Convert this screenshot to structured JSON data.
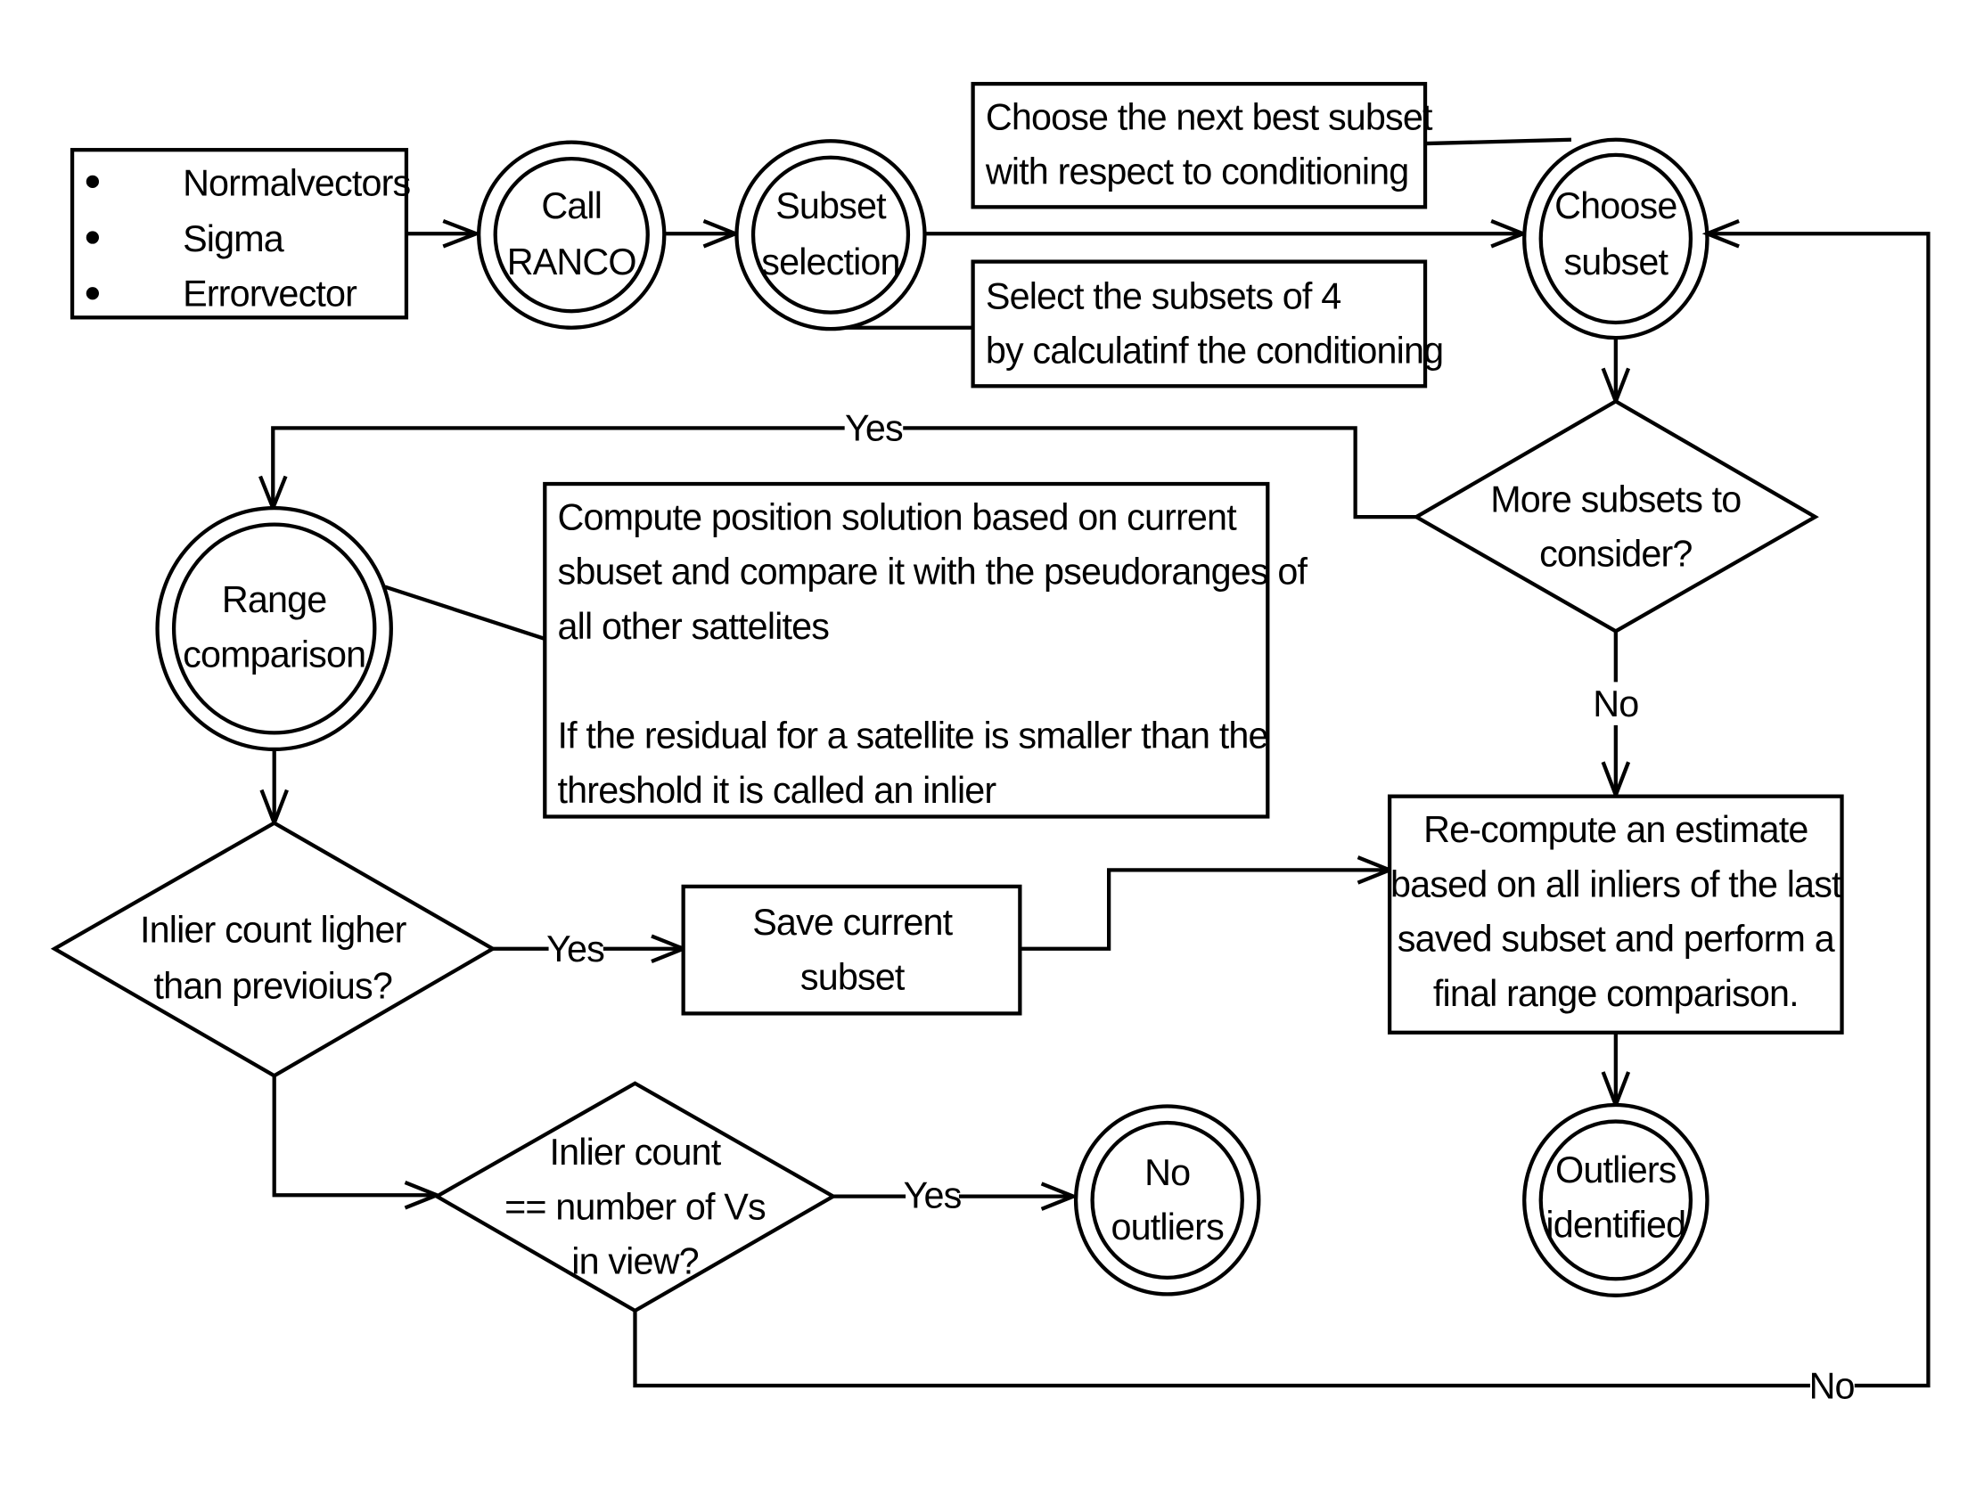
{
  "diagram": {
    "type": "flowchart",
    "input_box": {
      "bullet_icon": "bullet-dot",
      "items": [
        "Normalvectors",
        "Sigma",
        "Errorvector"
      ]
    },
    "nodes": {
      "call_ranco": [
        "Call",
        "RANCO"
      ],
      "subset_selection": [
        "Subset",
        "selection"
      ],
      "choose_subset": [
        "Choose",
        "subset"
      ],
      "more_subsets": [
        "More subsets to",
        "consider?"
      ],
      "range_comparison": [
        "Range",
        "comparison"
      ],
      "inlier_higher": [
        "Inlier count ligher",
        "than previoius?"
      ],
      "save_subset": [
        "Save current",
        "subset"
      ],
      "inlier_equal": [
        "Inlier count",
        "== number of Vs",
        "in view?"
      ],
      "no_outliers": [
        "No",
        "outliers"
      ],
      "recompute": [
        "Re-compute an estimate",
        "based on all inliers of the last",
        "saved subset and perform a",
        "final range comparison."
      ],
      "outliers_identified": [
        "Outliers",
        "identified"
      ]
    },
    "notes": {
      "next_best": [
        "Choose the next best subset",
        "with respect to conditioning"
      ],
      "select_subsets": [
        "Select the subsets of 4",
        "by calculatinf the conditioning"
      ],
      "compute_position": [
        "Compute position solution based on current",
        "sbuset and compare it with the pseudoranges of",
        "all other sattelites",
        "",
        "If the residual for a satellite is smaller than the",
        "threshold it is called an inlier"
      ]
    },
    "edge_labels": {
      "more_yes": "Yes",
      "more_no": "No",
      "higher_yes": "Yes",
      "equal_yes": "Yes",
      "equal_no": "No"
    }
  }
}
